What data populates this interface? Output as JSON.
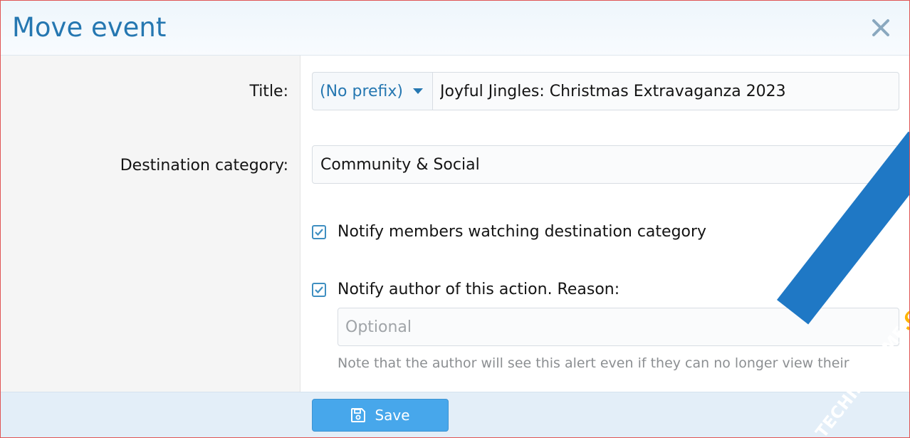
{
  "dialog": {
    "title": "Move event"
  },
  "form": {
    "title_label": "Title:",
    "prefix_value": "(No prefix)",
    "title_value": "Joyful Jingles: Christmas Extravaganza 2023",
    "destination_label": "Destination category:",
    "destination_value": "Community & Social",
    "notify_watchers_label": "Notify members watching destination category",
    "notify_watchers_checked": true,
    "notify_author_label": "Notify author of this action. Reason:",
    "notify_author_checked": true,
    "reason_placeholder": "Optional",
    "reason_hint": "Note that the author will see this alert even if they can no longer view their con"
  },
  "footer": {
    "save_label": "Save"
  },
  "watermark": {
    "text_main": "TECHIESHOME",
    "text_accent": ".COM"
  },
  "colors": {
    "accent": "#2577b1",
    "button": "#47a7eb",
    "watermark_band": "#1f78c5",
    "watermark_accent": "#ffb400"
  }
}
